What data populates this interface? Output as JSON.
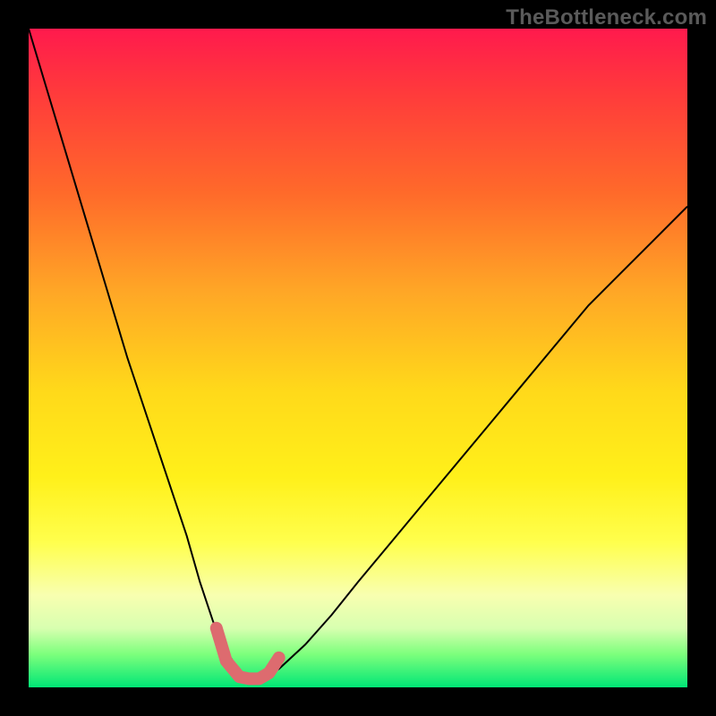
{
  "watermark": "TheBottleneck.com",
  "chart_data": {
    "type": "line",
    "title": "",
    "xlabel": "",
    "ylabel": "",
    "xlim": [
      0,
      100
    ],
    "ylim": [
      0,
      100
    ],
    "series": [
      {
        "name": "bottleneck-curve",
        "x": [
          0,
          3,
          6,
          9,
          12,
          15,
          18,
          21,
          24,
          26,
          28,
          30,
          32,
          33.5,
          35,
          38,
          42,
          46,
          50,
          55,
          60,
          65,
          70,
          75,
          80,
          85,
          90,
          95,
          100
        ],
        "values": [
          100,
          90,
          80,
          70,
          60,
          50,
          41,
          32,
          23,
          16,
          10,
          5.5,
          2.5,
          1.3,
          1.3,
          2.8,
          6.5,
          11,
          16,
          22,
          28,
          34,
          40,
          46,
          52,
          58,
          63,
          68,
          73
        ]
      }
    ],
    "highlight": {
      "name": "flat-minimum",
      "x": [
        28.5,
        30,
        32,
        33.5,
        35,
        36.5,
        38
      ],
      "values": [
        9,
        4,
        1.6,
        1.3,
        1.3,
        2.2,
        4.5
      ]
    },
    "colors": {
      "curve": "#000000",
      "highlight": "#dd6b6f",
      "gradient_top": "#ff1a4d",
      "gradient_bottom": "#00e676"
    }
  }
}
